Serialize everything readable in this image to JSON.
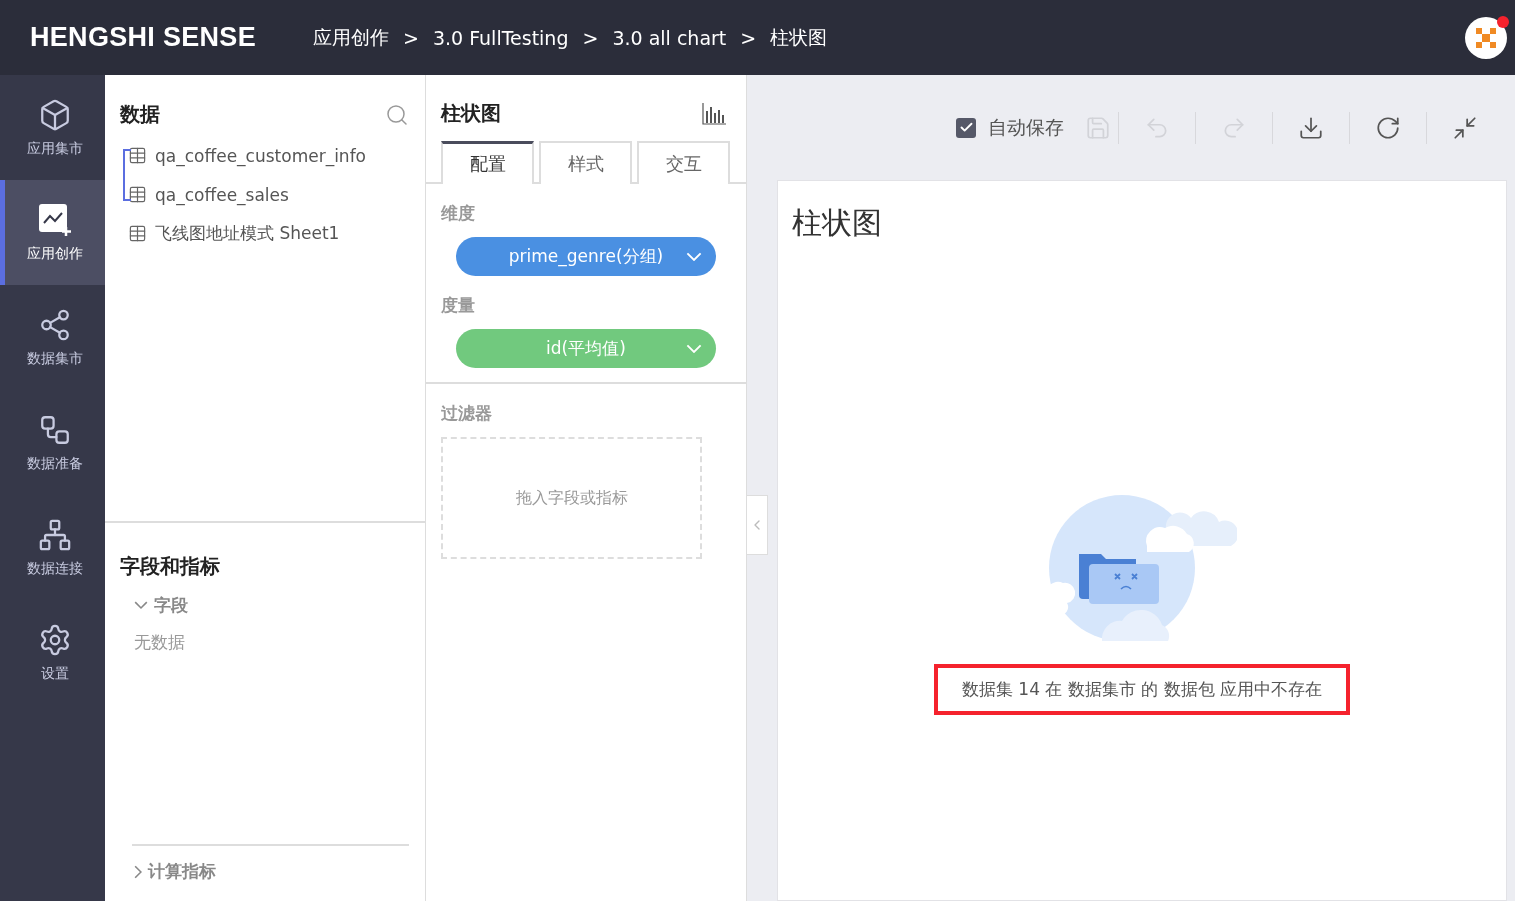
{
  "header": {
    "logo": "HENGSHI SENSE",
    "breadcrumbs": [
      {
        "label": "应用创作",
        "separator": ">"
      },
      {
        "label": "3.0 FullTesting",
        "separator": ">"
      },
      {
        "label": "3.0 all chart",
        "separator": ">"
      },
      {
        "label": "柱状图"
      }
    ],
    "avatar": {
      "notification": true
    }
  },
  "nav": [
    {
      "label": "应用集市",
      "kind": "market",
      "selected": false
    },
    {
      "label": "应用创作",
      "kind": "create",
      "selected": true
    },
    {
      "label": "数据集市",
      "kind": "datamarket",
      "selected": false
    },
    {
      "label": "数据准备",
      "kind": "prepare",
      "selected": false
    },
    {
      "label": "数据连接",
      "kind": "connect",
      "selected": false
    },
    {
      "label": "设置",
      "kind": "settings",
      "selected": false
    }
  ],
  "data_panel": {
    "title": "数据",
    "items": [
      {
        "kind": "group",
        "children": [
          {
            "label": "qa_coffee_customer_info"
          },
          {
            "label": "qa_coffee_sales"
          }
        ]
      },
      {
        "kind": "table",
        "label": "飞线图地址模式 Sheet1"
      }
    ]
  },
  "fields_panel": {
    "title": "字段和指标",
    "groups": [
      {
        "label": "字段",
        "expanded": true,
        "empty_text": "无数据"
      }
    ],
    "footer_group": {
      "label": "计算指标",
      "expanded": false
    }
  },
  "config_panel": {
    "title": "柱状图",
    "tabs": [
      {
        "label": "配置",
        "selected": true
      },
      {
        "label": "样式",
        "selected": false
      },
      {
        "label": "交互",
        "selected": false
      }
    ],
    "sections": [
      {
        "label": "维度",
        "pills": [
          {
            "text": "prime_genre(分组)",
            "kind": "dimension"
          }
        ]
      },
      {
        "label": "度量",
        "pills": [
          {
            "text": "id(平均值)",
            "kind": "measure"
          }
        ]
      }
    ],
    "filter": {
      "label": "过滤器",
      "placeholder": "拖入字段或指标"
    }
  },
  "toolbar": {
    "autosave": {
      "label": "自动保存",
      "checked": true
    },
    "buttons": [
      {
        "kind": "save",
        "disabled": true
      },
      {
        "kind": "undo",
        "disabled": true
      },
      {
        "kind": "redo",
        "disabled": true
      },
      {
        "kind": "download",
        "disabled": false
      },
      {
        "kind": "refresh",
        "disabled": false
      },
      {
        "kind": "collapse",
        "disabled": false
      }
    ]
  },
  "chart_card": {
    "title": "柱状图",
    "message": "数据集 14 在 数据集市 的 数据包 应用中不存在",
    "message_highlighted": true
  }
}
